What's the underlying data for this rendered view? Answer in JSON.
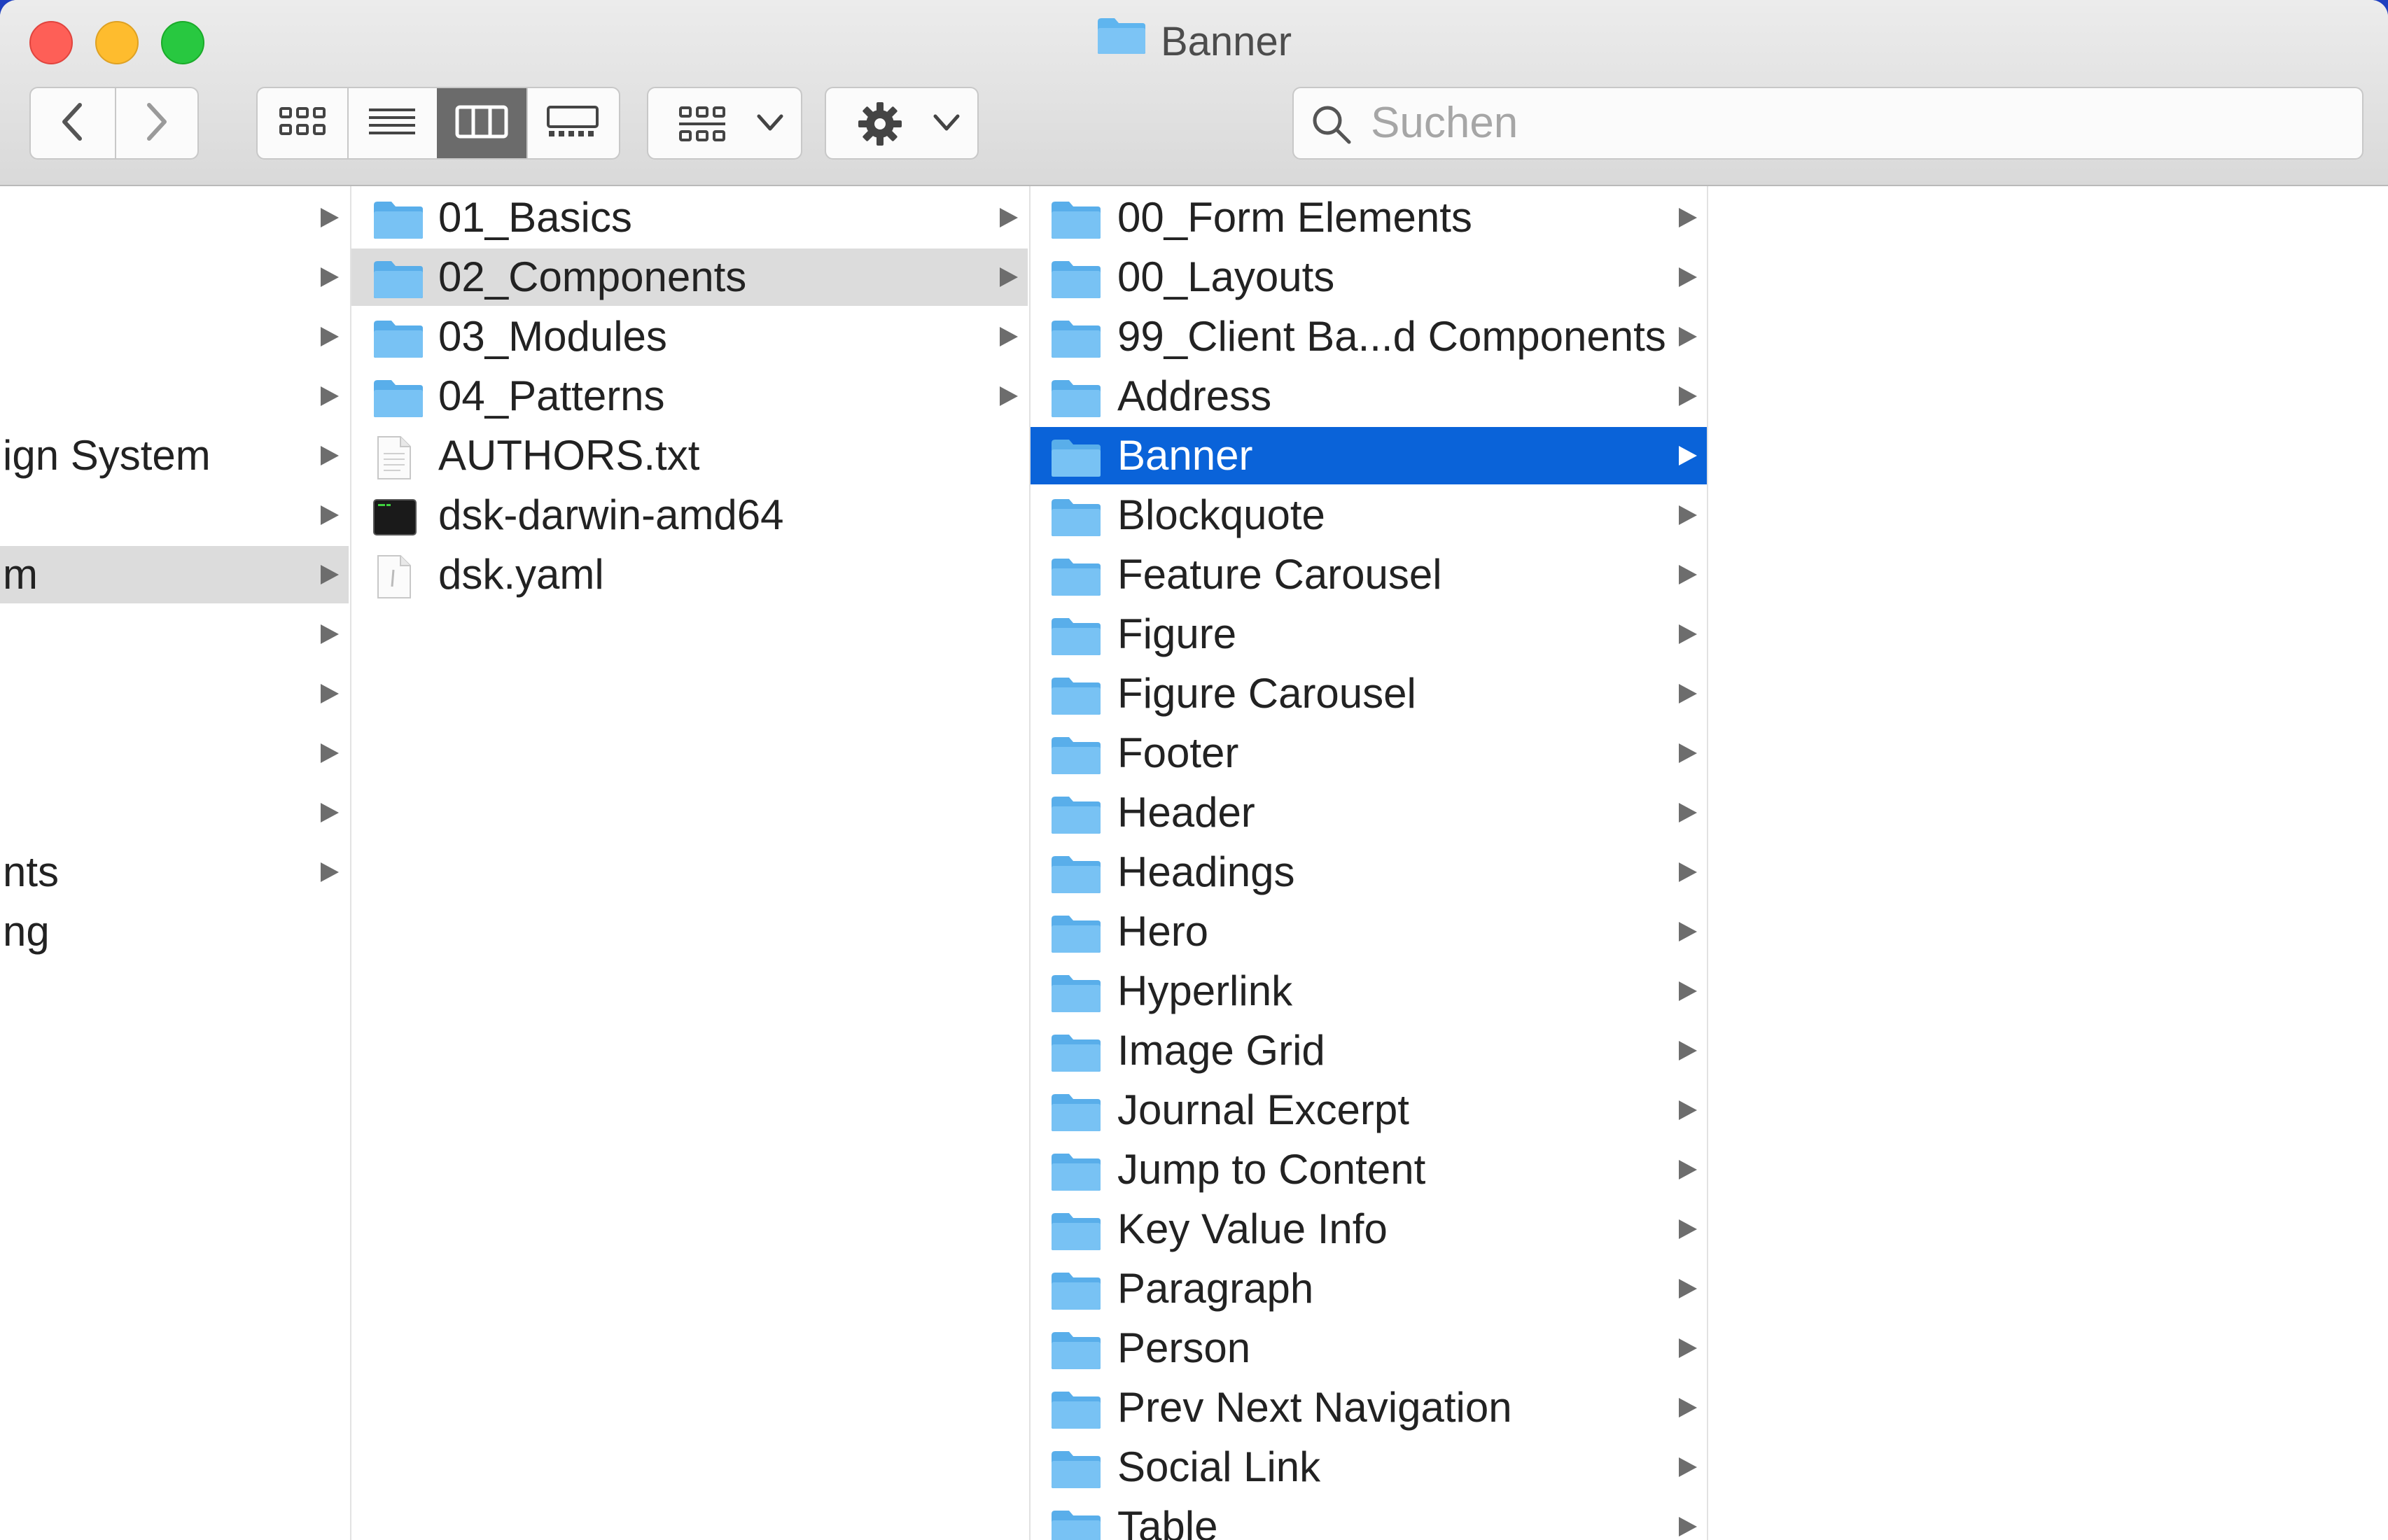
{
  "window": {
    "title": "Banner",
    "traffic_lights": {
      "close": "#fe5f57",
      "minimize": "#febc2e",
      "maximize": "#28c840"
    }
  },
  "toolbar": {
    "back_icon": "chevron-left-icon",
    "forward_icon": "chevron-right-icon",
    "view_modes": [
      "icon-view-icon",
      "list-view-icon",
      "column-view-icon",
      "gallery-view-icon"
    ],
    "active_view": "column-view-icon",
    "group_icon": "group-by-icon",
    "action_icon": "gear-icon",
    "search_placeholder": "Suchen"
  },
  "columns": {
    "col1": {
      "items": [
        {
          "label": "",
          "chevron": true
        },
        {
          "label": "",
          "chevron": true
        },
        {
          "label": "",
          "chevron": true
        },
        {
          "label": "",
          "chevron": true
        },
        {
          "label": "ign System",
          "chevron": true
        },
        {
          "label": "",
          "chevron": true
        },
        {
          "label": "m",
          "chevron": true,
          "selected": true
        },
        {
          "label": "",
          "chevron": true
        },
        {
          "label": "",
          "chevron": true
        },
        {
          "label": "",
          "chevron": true
        },
        {
          "label": "",
          "chevron": true
        },
        {
          "label": "nts",
          "chevron": true
        },
        {
          "label": "ng",
          "chevron": false
        }
      ]
    },
    "col2": {
      "items": [
        {
          "label": "01_Basics",
          "kind": "folder",
          "chevron": true
        },
        {
          "label": "02_Components",
          "kind": "folder",
          "chevron": true,
          "selected": true
        },
        {
          "label": "03_Modules",
          "kind": "folder",
          "chevron": true
        },
        {
          "label": "04_Patterns",
          "kind": "folder",
          "chevron": true
        },
        {
          "label": "AUTHORS.txt",
          "kind": "text-file",
          "chevron": false
        },
        {
          "label": "dsk-darwin-amd64",
          "kind": "executable",
          "chevron": false
        },
        {
          "label": "dsk.yaml",
          "kind": "yaml-file",
          "chevron": false
        }
      ]
    },
    "col3": {
      "selected_color": "#0a63d9",
      "items": [
        {
          "label": "00_Form Elements"
        },
        {
          "label": "00_Layouts"
        },
        {
          "label": "99_Client Ba...d Components"
        },
        {
          "label": "Address"
        },
        {
          "label": "Banner",
          "selected": true
        },
        {
          "label": "Blockquote"
        },
        {
          "label": "Feature Carousel"
        },
        {
          "label": "Figure"
        },
        {
          "label": "Figure Carousel"
        },
        {
          "label": "Footer"
        },
        {
          "label": "Header"
        },
        {
          "label": "Headings"
        },
        {
          "label": "Hero"
        },
        {
          "label": "Hyperlink"
        },
        {
          "label": "Image Grid"
        },
        {
          "label": "Journal Excerpt"
        },
        {
          "label": "Jump to Content"
        },
        {
          "label": "Key Value Info"
        },
        {
          "label": "Paragraph"
        },
        {
          "label": "Person"
        },
        {
          "label": "Prev Next Navigation"
        },
        {
          "label": "Social Link"
        },
        {
          "label": "Table"
        }
      ]
    }
  }
}
